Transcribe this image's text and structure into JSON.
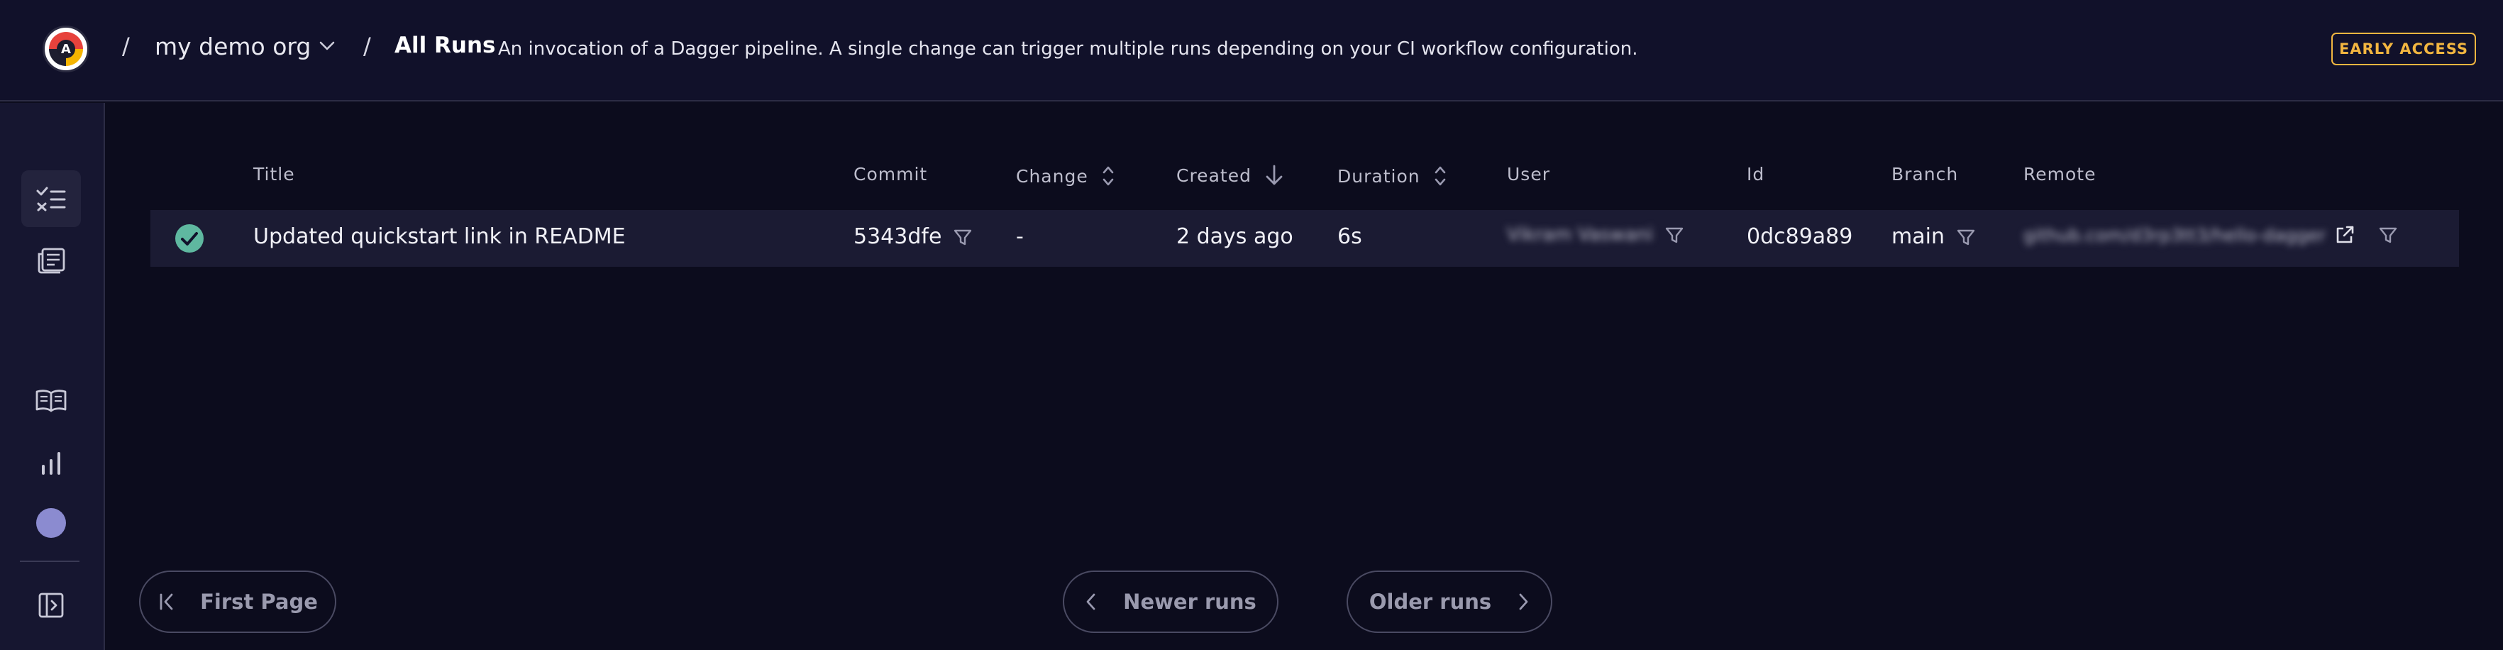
{
  "header": {
    "separator": "/",
    "org_name": "my demo org",
    "page_title": "All Runs",
    "page_description": "An invocation of a Dagger pipeline. A single change can trigger multiple runs depending on your CI workflow configuration.",
    "early_access_label": "EARLY ACCESS",
    "logo_letter": "A"
  },
  "sidebar": {
    "items": [
      {
        "icon": "runs-list-icon",
        "active": true
      },
      {
        "icon": "news-feed-icon",
        "active": false
      },
      {
        "icon": "book-open-icon",
        "active": false
      },
      {
        "icon": "bar-chart-icon",
        "active": false
      },
      {
        "icon": "avatar",
        "active": false
      },
      {
        "icon": "sidebar-toggle-icon",
        "active": false
      }
    ]
  },
  "table": {
    "columns": [
      "Title",
      "Commit",
      "Change",
      "Created",
      "Duration",
      "User",
      "Id",
      "Branch",
      "Remote"
    ],
    "rows": [
      {
        "status": "success",
        "title": "Updated quickstart link in README",
        "commit": "5343dfe",
        "change": "-",
        "created": "2 days ago",
        "duration": "6s",
        "user": "Vikram Vaswani",
        "id": "0dc89a89",
        "branch": "main",
        "remote": "github.com/d3rp3tt3/hello-dagger"
      }
    ]
  },
  "pagination": {
    "first_page": "First Page",
    "newer_runs": "Newer runs",
    "older_runs": "Older runs"
  },
  "colors": {
    "background": "#0c0c1d",
    "accent_warning": "#f2b640",
    "success": "#5fb8a0",
    "avatar": "#8b8bd0"
  }
}
